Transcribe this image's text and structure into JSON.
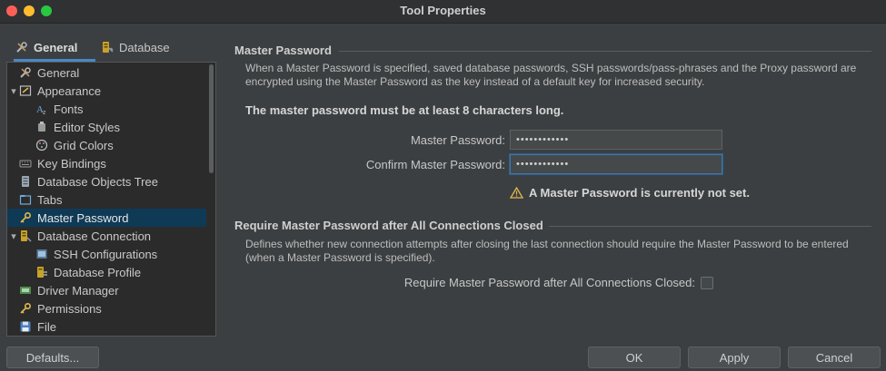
{
  "window": {
    "title": "Tool Properties"
  },
  "tabs": [
    {
      "label": "General",
      "icon": "wrench-screwdriver-icon"
    },
    {
      "label": "Database",
      "icon": "database-icon"
    }
  ],
  "tree": {
    "items": [
      {
        "label": "General",
        "icon": "tools-icon",
        "level": 0,
        "expander": ""
      },
      {
        "label": "Appearance",
        "icon": "appearance-icon",
        "level": 0,
        "expander": "▾"
      },
      {
        "label": "Fonts",
        "icon": "font-icon",
        "level": 1,
        "expander": ""
      },
      {
        "label": "Editor Styles",
        "icon": "paint-bucket-icon",
        "level": 1,
        "expander": ""
      },
      {
        "label": "Grid Colors",
        "icon": "palette-icon",
        "level": 1,
        "expander": ""
      },
      {
        "label": "Key Bindings",
        "icon": "keyboard-icon",
        "level": 0,
        "expander": ""
      },
      {
        "label": "Database Objects Tree",
        "icon": "tree-icon",
        "level": 0,
        "expander": ""
      },
      {
        "label": "Tabs",
        "icon": "tabs-icon",
        "level": 0,
        "expander": ""
      },
      {
        "label": "Master Password",
        "icon": "key-icon",
        "level": 0,
        "expander": "",
        "selected": true
      },
      {
        "label": "Database Connection",
        "icon": "database-connection-icon",
        "level": 0,
        "expander": "▾"
      },
      {
        "label": "SSH Configurations",
        "icon": "ssh-icon",
        "level": 1,
        "expander": ""
      },
      {
        "label": "Database Profile",
        "icon": "database-profile-icon",
        "level": 1,
        "expander": ""
      },
      {
        "label": "Driver Manager",
        "icon": "driver-icon",
        "level": 0,
        "expander": ""
      },
      {
        "label": "Permissions",
        "icon": "key-icon",
        "level": 0,
        "expander": ""
      },
      {
        "label": "File",
        "icon": "floppy-disk-icon",
        "level": 0,
        "expander": ""
      }
    ]
  },
  "master_password": {
    "section_title": "Master Password",
    "description": "When a Master Password is specified, saved database passwords, SSH passwords/pass-phrases and the Proxy password are encrypted using the Master Password as the key instead of a default key for increased security.",
    "length_note": "The master password must be at least 8 characters long.",
    "password_label": "Master Password:",
    "password_value": "••••••••••••",
    "confirm_label": "Confirm Master Password:",
    "confirm_value": "••••••••••••",
    "warning": "A Master Password is currently not set."
  },
  "require_section": {
    "section_title": "Require Master Password after All Connections Closed",
    "description": "Defines whether new connection attempts after closing the last connection should require the Master Password to be entered (when a Master Password is specified).",
    "checkbox_label": "Require Master Password after All Connections Closed:",
    "checked": false
  },
  "buttons": {
    "defaults": "Defaults...",
    "ok": "OK",
    "apply": "Apply",
    "cancel": "Cancel"
  },
  "colors": {
    "background": "#3c3f41",
    "tree_background": "#2b2b2b",
    "selection": "#0f3a56",
    "accent": "#4a88c7",
    "warning": "#e0b84c"
  }
}
